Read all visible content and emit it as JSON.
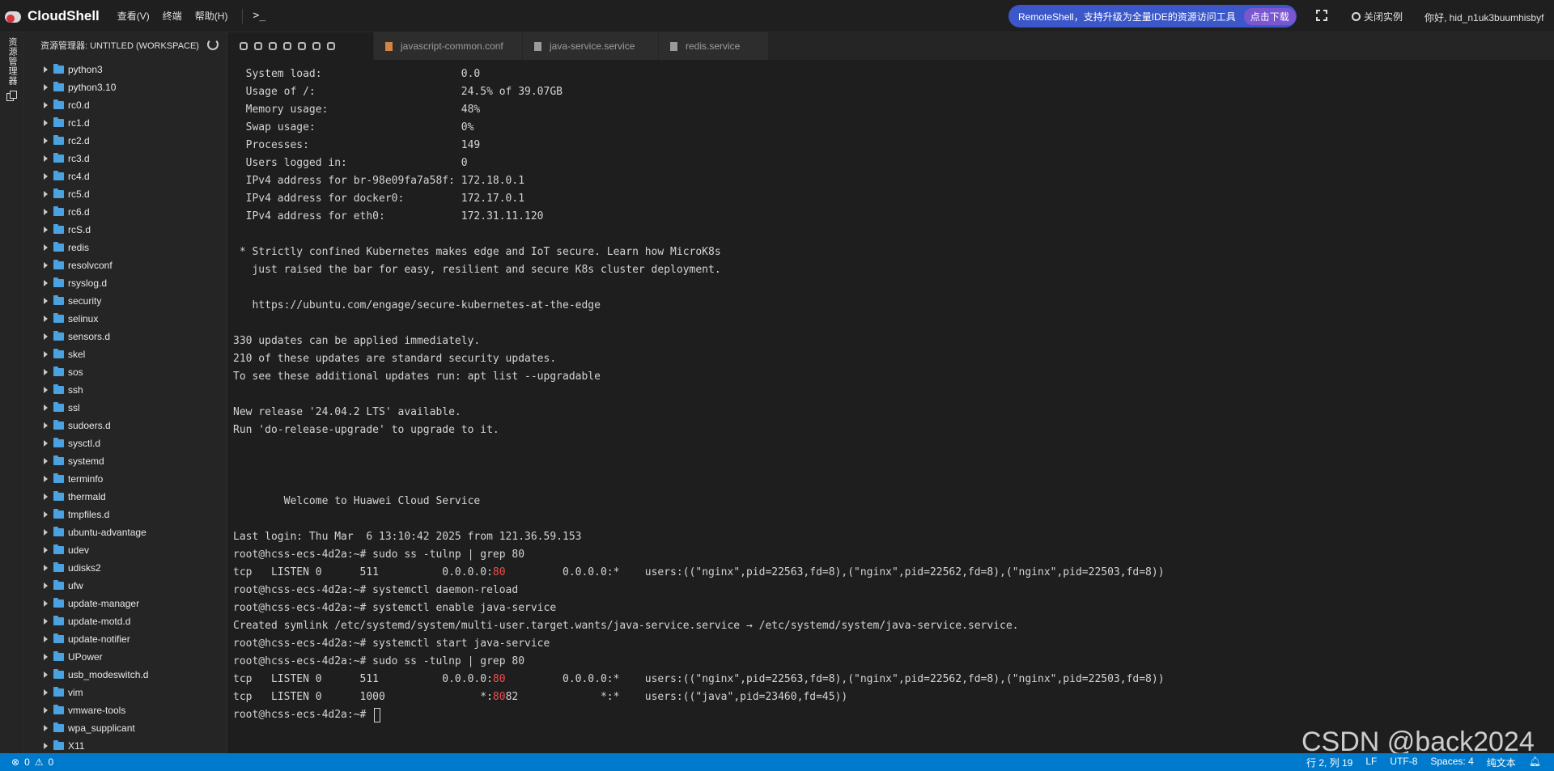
{
  "app": {
    "title": "CloudShell",
    "menu": [
      "查看(V)",
      "终端",
      "帮助(H)"
    ],
    "terminal_icon": ">_"
  },
  "promo": {
    "text": "RemoteShell，支持升级为全量IDE的资源访问工具",
    "button": "点击下载"
  },
  "header": {
    "close_instance": "关闭实例",
    "greeting": "你好, hid_n1uk3buumhisbyf"
  },
  "activity": {
    "label": "资源管理器"
  },
  "sidebar": {
    "title": "资源管理器: UNTITLED (WORKSPACE)",
    "items": [
      "python3",
      "python3.10",
      "rc0.d",
      "rc1.d",
      "rc2.d",
      "rc3.d",
      "rc4.d",
      "rc5.d",
      "rc6.d",
      "rcS.d",
      "redis",
      "resolvconf",
      "rsyslog.d",
      "security",
      "selinux",
      "sensors.d",
      "skel",
      "sos",
      "ssh",
      "ssl",
      "sudoers.d",
      "sysctl.d",
      "systemd",
      "terminfo",
      "thermald",
      "tmpfiles.d",
      "ubuntu-advantage",
      "udev",
      "udisks2",
      "ufw",
      "update-manager",
      "update-motd.d",
      "update-notifier",
      "UPower",
      "usb_modeswitch.d",
      "vim",
      "vmware-tools",
      "wpa_supplicant",
      "X11"
    ]
  },
  "tabs": [
    "javascript-common.conf",
    "java-service.service",
    "redis.service"
  ],
  "terminal": {
    "lines": [
      "  System load:                      0.0",
      "  Usage of /:                       24.5% of 39.07GB",
      "  Memory usage:                     48%",
      "  Swap usage:                       0%",
      "  Processes:                        149",
      "  Users logged in:                  0",
      "  IPv4 address for br-98e09fa7a58f: 172.18.0.1",
      "  IPv4 address for docker0:         172.17.0.1",
      "  IPv4 address for eth0:            172.31.11.120",
      "",
      " * Strictly confined Kubernetes makes edge and IoT secure. Learn how MicroK8s",
      "   just raised the bar for easy, resilient and secure K8s cluster deployment.",
      "",
      "   https://ubuntu.com/engage/secure-kubernetes-at-the-edge",
      "",
      "330 updates can be applied immediately.",
      "210 of these updates are standard security updates.",
      "To see these additional updates run: apt list --upgradable",
      "",
      "New release '24.04.2 LTS' available.",
      "Run 'do-release-upgrade' to upgrade to it.",
      "",
      "",
      "",
      "        Welcome to Huawei Cloud Service",
      "",
      "Last login: Thu Mar  6 13:10:42 2025 from 121.36.59.153",
      "root@hcss-ecs-4d2a:~# sudo ss -tulnp | grep 80",
      [
        "tcp   LISTEN 0      511          0.0.0.0:",
        "80",
        "         0.0.0.0:*    users:((\"nginx\",pid=22563,fd=8),(\"nginx\",pid=22562,fd=8),(\"nginx\",pid=22503,fd=8))"
      ],
      "root@hcss-ecs-4d2a:~# systemctl daemon-reload",
      "root@hcss-ecs-4d2a:~# systemctl enable java-service",
      "Created symlink /etc/systemd/system/multi-user.target.wants/java-service.service → /etc/systemd/system/java-service.service.",
      "root@hcss-ecs-4d2a:~# systemctl start java-service",
      "root@hcss-ecs-4d2a:~# sudo ss -tulnp | grep 80",
      [
        "tcp   LISTEN 0      511          0.0.0.0:",
        "80",
        "         0.0.0.0:*    users:((\"nginx\",pid=22563,fd=8),(\"nginx\",pid=22562,fd=8),(\"nginx\",pid=22503,fd=8))"
      ],
      [
        "tcp   LISTEN 0      1000               *:",
        "80",
        "82             *:*    users:((\"java\",pid=23460,fd=45))"
      ],
      "root@hcss-ecs-4d2a:~# "
    ]
  },
  "watermark": "CSDN @back2024",
  "status": {
    "errors": "0",
    "warnings": "0",
    "position": "行 2, 列 19",
    "eol": "LF",
    "encoding": "UTF-8",
    "spaces": "Spaces: 4",
    "language": "纯文本"
  }
}
